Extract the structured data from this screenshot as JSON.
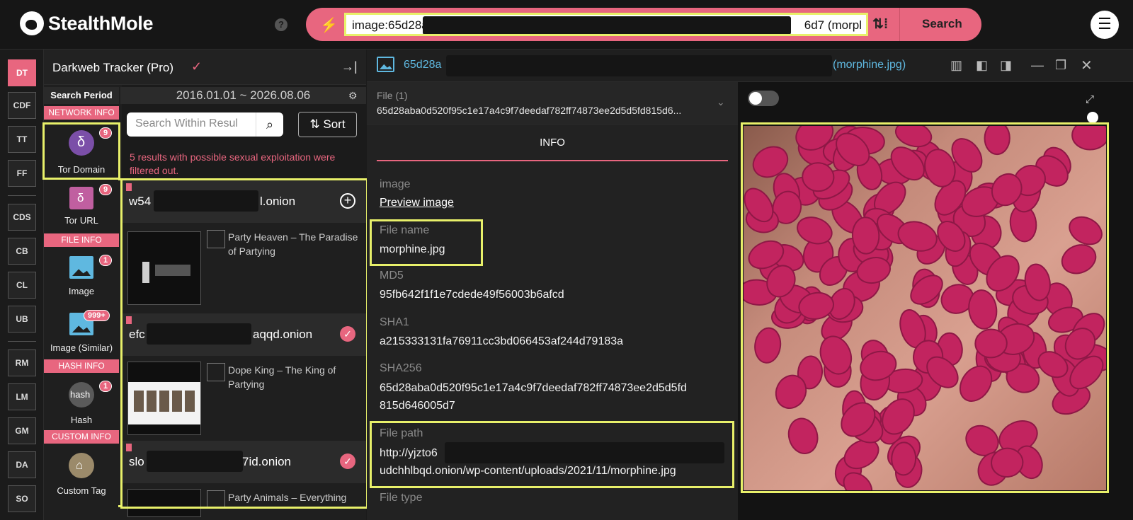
{
  "app": {
    "name": "StealthMole",
    "help": "?",
    "menu": "☰"
  },
  "search": {
    "query_start": "image:65d28a",
    "query_end": "6d7 (morpl",
    "button": "Search",
    "filter_icon": "sliders-icon"
  },
  "rail": [
    "DT",
    "CDF",
    "TT",
    "FF",
    "CDS",
    "CB",
    "CL",
    "UB",
    "RM",
    "LM",
    "GM",
    "DA",
    "SO"
  ],
  "sidebar": {
    "title": "Darkweb Tracker (Pro)",
    "search_period_label": "Search Period",
    "categories": {
      "network": "NETWORK INFO",
      "file": "FILE INFO",
      "hash": "HASH INFO",
      "custom": "CUSTOM INFO"
    },
    "items": [
      {
        "label": "Tor Domain",
        "badge": "9"
      },
      {
        "label": "Tor URL",
        "badge": "9"
      },
      {
        "label": "Image",
        "badge": "1"
      },
      {
        "label": "Image (Similar)",
        "badge": "999+"
      },
      {
        "label": "Hash",
        "badge": "1",
        "icon_text": "hash"
      },
      {
        "label": "Custom Tag",
        "badge": ""
      }
    ]
  },
  "results": {
    "period": "2016.01.01 ~ 2026.08.06",
    "search_placeholder": "Search Within Resul",
    "sort_label": "Sort",
    "warning": "5 results with possible sexual exploitation were filtered out.",
    "items": [
      {
        "prefix": "w54",
        "suffix": "l.onion",
        "title": "Party Heaven – The Paradise of Partying"
      },
      {
        "prefix": "efc",
        "suffix": "aqqd.onion",
        "title": "Dope King – The King of Partying"
      },
      {
        "prefix": "slo",
        "suffix": "7id.onion",
        "title": "Party Animals – Everything"
      }
    ]
  },
  "detail": {
    "title_prefix": "65d28a",
    "title_suffix": "(morphine.jpg)",
    "file_label": "File (1)",
    "file_hash": "65d28aba0d520f95c1e17a4c9f7deedaf782ff74873ee2d5d5fd815d6...",
    "tab": "INFO",
    "image_label": "image",
    "preview_link": "Preview image",
    "filename_label": "File name",
    "filename": "morphine.jpg",
    "md5_label": "MD5",
    "md5": "95fb642f1f1e7cdede49f56003b6afcd",
    "sha1_label": "SHA1",
    "sha1": "a215333131fa76911cc3bd066453af244d79183a",
    "sha256_label": "SHA256",
    "sha256_line1": "65d28aba0d520f95c1e17a4c9f7deedaf782ff74873ee2d5d5fd",
    "sha256_line2": "815d646005d7",
    "path_label": "File path",
    "path_prefix": "http://yjzto6",
    "path_line2": "udchhlbqd.onion/wp-content/uploads/2021/11/morphine.jpg",
    "type_label": "File type"
  },
  "colors": {
    "accent": "#e8667f",
    "highlight": "#e8f06a",
    "link": "#5fb8e0",
    "pill": "#c2245f"
  }
}
